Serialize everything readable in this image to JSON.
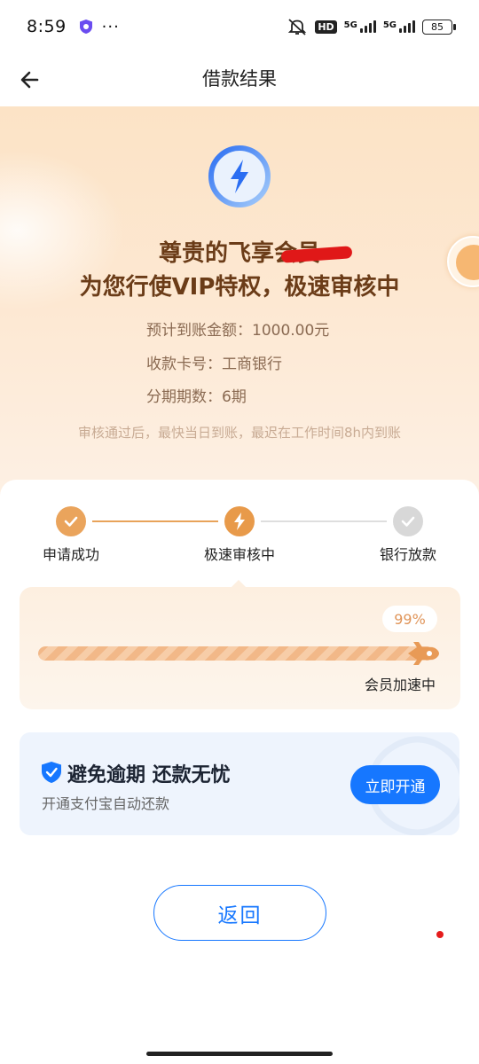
{
  "status_bar": {
    "time": "8:59",
    "dots": "···",
    "hd": "HD",
    "sim1": "5G",
    "sim2": "5G",
    "battery": "85"
  },
  "header": {
    "title": "借款结果",
    "back_icon": "arrow-left-icon"
  },
  "hero": {
    "icon": "lightning-bolt-icon",
    "line1": "尊贵的飞享会员",
    "line2": "为您行使VIP特权，极速审核中",
    "amount": "预计到账金额：1000.00元",
    "card": "收款卡号：工商银行",
    "period": "分期期数：6期",
    "note": "审核通过后，最快当日到账，最迟在工作时间8h内到账"
  },
  "steps": [
    {
      "label": "申请成功",
      "state": "done"
    },
    {
      "label": "极速审核中",
      "state": "active"
    },
    {
      "label": "银行放款",
      "state": "pending"
    }
  ],
  "progress": {
    "percent": 99,
    "percent_label": "99%",
    "label": "会员加速中"
  },
  "promo": {
    "title": "避免逾期 还款无忧",
    "subtitle": "开通支付宝自动还款",
    "button": "立即开通"
  },
  "actions": {
    "return": "返回"
  },
  "colors": {
    "accent": "#1677ff",
    "brown": "#6b3c18",
    "orange": "#e89a4a"
  }
}
